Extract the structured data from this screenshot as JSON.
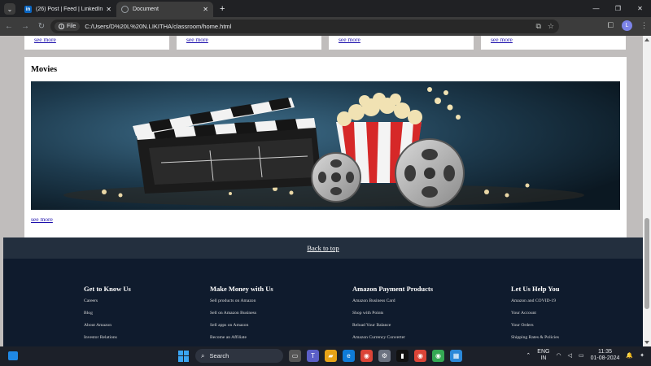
{
  "browser": {
    "tabs": [
      {
        "title": "(26) Post | Feed | LinkedIn",
        "active": false,
        "favicon": "linkedin-icon"
      },
      {
        "title": "Document",
        "active": true,
        "favicon": "globe-icon"
      }
    ],
    "new_tab_label": "+",
    "address_chip": "File",
    "url": "C:/Users/D%20L%20N.LIKITHA/classroom/home.html",
    "profile_initial": "L"
  },
  "page": {
    "top_cards_link": "see more",
    "movies": {
      "title": "Movies",
      "link": "see more"
    },
    "back_to_top": "Back to top",
    "footer": {
      "columns": [
        {
          "heading": "Get to Know Us",
          "items": [
            "Careers",
            "Blog",
            "About Amazon",
            "Investor Relations"
          ]
        },
        {
          "heading": "Make Money with Us",
          "items": [
            "Sell products on Amazon",
            "Sell on Amazon Business",
            "Sell apps on Amazon",
            "Become an Affiliate"
          ]
        },
        {
          "heading": "Amazon Payment Products",
          "items": [
            "Amazon Business Card",
            "Shop with Points",
            "Reload Your Balance",
            "Amazon Currency Converter"
          ]
        },
        {
          "heading": "Let Us Help You",
          "items": [
            "Amazon and COVID-19",
            "Your Account",
            "Your Orders",
            "Shipping Rates & Policies"
          ]
        }
      ]
    }
  },
  "taskbar": {
    "search_placeholder": "Search",
    "lang_top": "ENG",
    "lang_bottom": "IN",
    "time": "11:35",
    "date": "01-08-2024"
  }
}
